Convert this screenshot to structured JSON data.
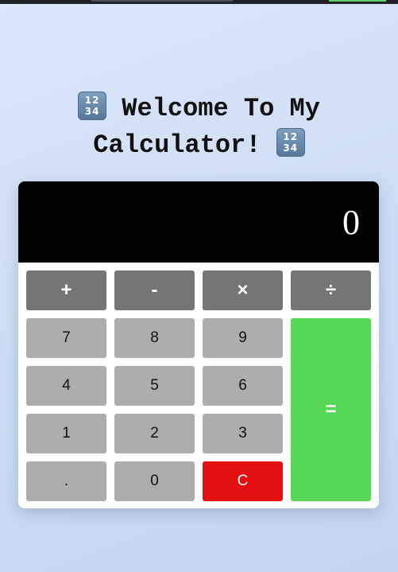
{
  "title": {
    "line1": "Welcome To My",
    "line2": "Calculator!",
    "emoji_top": "12",
    "emoji_bottom": "34",
    "icon": "input-numbers-icon"
  },
  "display": {
    "value": "0"
  },
  "operators": {
    "add": "+",
    "subtract": "-",
    "multiply": "×",
    "divide": "÷"
  },
  "keys": {
    "seven": "7",
    "eight": "8",
    "nine": "9",
    "four": "4",
    "five": "5",
    "six": "6",
    "one": "1",
    "two": "2",
    "three": "3",
    "decimal": ".",
    "zero": "0",
    "clear": "C",
    "equals": "="
  },
  "colors": {
    "operator_bg": "#757575",
    "digit_bg": "#adadad",
    "clear_bg": "#e30f11",
    "equals_bg": "#57d957",
    "display_bg": "#000000"
  }
}
